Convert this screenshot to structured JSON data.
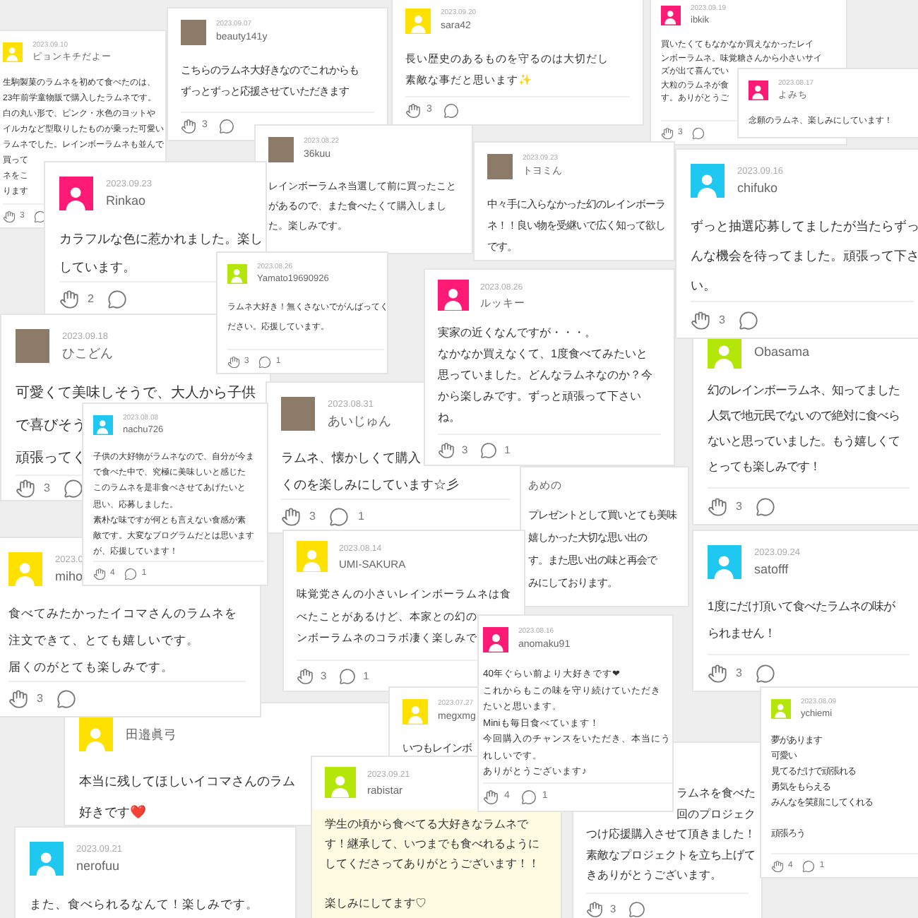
{
  "cards": [
    {
      "date": "2023.09.10",
      "name": "ピョンキチだよー",
      "avatar": {
        "kind": "icon",
        "color": "#ffe100"
      },
      "body": [
        [
          "生駒製菓のラムネを初めて食べたのは、",
          "23年前学童物販で購入したラムネです。",
          "白の丸い形で、ピンク・水色のヨットや",
          "イルカなど型取りしたものが乗った可愛い",
          "ラムネでした。レインボーラムネも並んで",
          "買って",
          "ネをこ",
          "ります"
        ]
      ],
      "footer": {
        "likes": "3"
      }
    },
    {
      "date": "2023.09.07",
      "name": "beauty141y",
      "avatar": {
        "kind": "photo"
      },
      "body": [
        [
          "こちらのラムネ大好きなのでこれからも",
          "ずっとずっと応援させていただきます"
        ]
      ],
      "footer": {
        "likes": "3"
      }
    },
    {
      "date": "2023.09.20",
      "name": "sara42",
      "avatar": {
        "kind": "icon",
        "color": "#ffe100"
      },
      "body": [
        [
          "長い歴史のあるものを守るのは大切だし",
          "素敵な事だと思います✨"
        ]
      ],
      "footer": {
        "likes": "3"
      }
    },
    {
      "date": "2023.09.19",
      "name": "ibkik",
      "avatar": {
        "kind": "icon",
        "color": "#ff1a75"
      },
      "body": [
        [
          "買いたくてもなかなか買えなかったレイ",
          "ンボーラムネ。味覚糖さんから小さいサイ",
          "ズが出て喜んでい",
          "大粒のラムネが食",
          "す。ありがとうご"
        ]
      ],
      "footer": {
        "likes": "3"
      }
    },
    {
      "date": "2023.08.17",
      "name": "よみち",
      "avatar": {
        "kind": "icon",
        "color": "#ff1a75"
      },
      "body": [
        [
          "念願のラムネ、楽しみにしています！"
        ]
      ]
    },
    {
      "date": "2023.08.22",
      "name": "36kuu",
      "avatar": {
        "kind": "photo"
      },
      "body": [
        [
          "レインボーラムネ当選して前に買ったこと",
          "があるので、また食べたくて購入しまし",
          "た。楽しみです。"
        ]
      ]
    },
    {
      "date": "2023.09.23",
      "name": "トヨミん",
      "avatar": {
        "kind": "photo"
      },
      "body": [
        [
          "中々手に入らなかった幻のレインボーラ",
          "ネ！！良い物を受継いで広く知って欲し",
          "です。"
        ]
      ]
    },
    {
      "date": "2023.09.23",
      "name": "Rinkao",
      "avatar": {
        "kind": "icon",
        "color": "#ff1a75"
      },
      "body": [
        [
          "カラフルな色に惹かれました。楽し",
          "しています。"
        ]
      ],
      "footer": {
        "likes": "2"
      }
    },
    {
      "date": "2023.09.16",
      "name": "chifuko",
      "avatar": {
        "kind": "icon",
        "color": "#1ec8f0"
      },
      "body": [
        [
          "ずっと抽選応募してましたが当たらずっ",
          "んな機会を待ってました。頑張って下さ",
          "い。"
        ]
      ],
      "footer": {
        "likes": "3"
      }
    },
    {
      "date": "2023.08.26",
      "name": "Yamato19690926",
      "avatar": {
        "kind": "icon",
        "color": "#b4e60a"
      },
      "body": [
        [
          "ラムネ大好き！無くさないでがんばってく",
          "ださい。応援しています。"
        ]
      ],
      "footer": {
        "likes": "3",
        "comments": "1"
      }
    },
    {
      "date": "2023.08.26",
      "name": "ルッキー",
      "avatar": {
        "kind": "icon",
        "color": "#ff1a75"
      },
      "body": [
        [
          "実家の近くなんですが・・・。",
          "なかなか買えなくて、1度食べてみたいと",
          "思っていました。どんなラムネなのか？今",
          "から楽しみです。ずっと頑張って下さい",
          "ね。"
        ]
      ],
      "footer": {
        "likes": "3",
        "comments": "1"
      }
    },
    {
      "date": "2023.09.18",
      "name": "ひこどん",
      "avatar": {
        "kind": "photo"
      },
      "body": [
        [
          "可愛くて美味しそうで、大人から子供",
          "で喜びそう",
          "頑張ってく"
        ]
      ],
      "footer": {
        "likes": "3"
      }
    },
    {
      "name": "Obasama",
      "avatar": {
        "kind": "icon",
        "color": "#b4e60a"
      },
      "body": [
        [
          "幻のレインボーラムネ、知ってました",
          "人気で地元民でないので絶対に食べら",
          "ないと思っていました。もう嬉しくて",
          "とっても楽しみです！"
        ]
      ],
      "footer": {
        "likes": "3"
      }
    },
    {
      "date": "2023.08.31",
      "name": "あいじゅん",
      "avatar": {
        "kind": "photo"
      },
      "body": [
        [
          "ラムネ、懐かしくて購入",
          "くのを楽しみにしています☆彡"
        ]
      ],
      "footer": {
        "likes": "3",
        "comments": "1"
      }
    },
    {
      "date": "2023.08.08",
      "name": "nachu726",
      "avatar": {
        "kind": "icon",
        "color": "#1ec8f0"
      },
      "body": [
        [
          "子供の大好物がラムネなので、自分が今ま",
          "で食べた中で、究極に美味しいと感じた",
          "このラムネを是非食べさせてあげたいと",
          "思い、応募しました。",
          "素朴な味ですが何とも言えない食感が素",
          "敵です。大変なプログラムだとは思います",
          "が、応援しています！"
        ]
      ],
      "footer": {
        "likes": "4",
        "comments": "1"
      }
    },
    {
      "name": "あめの",
      "body": [
        [
          "プレゼントとして買いとても美味",
          "嬉しかった大切な思い出の",
          "す。また思い出の味と再会で",
          "みにしております。"
        ]
      ]
    },
    {
      "date": "2023.0",
      "name": "miho",
      "avatar": {
        "kind": "icon",
        "color": "#ffe100"
      },
      "body": [
        [
          "食べてみたかったイコマさんのラムネを",
          "注文できて、とても嬉しいです。",
          "届くのがとても楽しみです。"
        ]
      ],
      "footer": {
        "likes": "3"
      }
    },
    {
      "date": "2023.08.14",
      "name": "UMI-SAKURA",
      "avatar": {
        "kind": "icon",
        "color": "#ffe100"
      },
      "body": [
        [
          "味覚党さんの小さいレインボーラムネは食",
          "べたことがあるけど、本家との幻の",
          "ンボーラムネのコラボ凄く楽しみで"
        ]
      ],
      "footer": {
        "likes": "3",
        "comments": "1"
      }
    },
    {
      "date": "2023.09.24",
      "name": "satofff",
      "avatar": {
        "kind": "icon",
        "color": "#1ec8f0"
      },
      "body": [
        [
          "1度にだけ頂いて食べたラムネの味が",
          "られません！"
        ]
      ],
      "footer": {
        "likes": "3"
      }
    },
    {
      "date": "2023.08.16",
      "name": "anomaku91",
      "avatar": {
        "kind": "icon",
        "color": "#ff1a75"
      },
      "body": [
        [
          "40年ぐらい前より大好きです❤",
          "これからもこの味を守り続けていただき",
          "たいと思います。",
          "Miniも毎日食べています！",
          "今回購入のチャンスをいただき、本当にう",
          "れしいです。",
          "ありがとうございます♪"
        ]
      ],
      "footer": {
        "likes": "4",
        "comments": "1"
      }
    },
    {
      "name": "田邉眞弓",
      "avatar": {
        "kind": "icon",
        "color": "#ffe100"
      },
      "body": [
        [
          "本当に残してほしいイコマさんのラム",
          "好きです❤️"
        ]
      ]
    },
    {
      "date": "2023.07.27",
      "name": "megxmg",
      "avatar": {
        "kind": "icon",
        "color": "#ffe100"
      },
      "body": [
        [
          "いつもレインボ"
        ]
      ]
    },
    {
      "date": "2023.09.21",
      "name": "rabistar",
      "avatar": {
        "kind": "icon",
        "color": "#b4e60a"
      },
      "highlighted": true,
      "body": [
        [
          "学生の頃から食べてる大好きなラムネで",
          "す！継承して、いつまでも食べれるように",
          "してくださってありがとうございます！！"
        ],
        [
          "楽しみにしてます♡"
        ]
      ]
    },
    {
      "body": [
        [
          "ラムネを食べた",
          "回のプロジェク",
          "つけ応援購入させて頂きました！",
          "素敵なプロジェクトを立ち上げて",
          "きありがとうございます。"
        ]
      ],
      "footer": {
        "likes": "3"
      }
    },
    {
      "date": "2023.08.09",
      "name": "ychiemi",
      "avatar": {
        "kind": "icon",
        "color": "#b4e60a"
      },
      "body": [
        [
          "夢があります",
          "可愛い",
          "見てるだけで頑張れる",
          "勇気をもらえる",
          "みんなを笑顔にしてくれる"
        ],
        [
          "頑張ろう"
        ]
      ],
      "footer": {
        "likes": "4",
        "comments": "1"
      }
    },
    {
      "date": "2023.09.21",
      "name": "nerofuu",
      "avatar": {
        "kind": "icon",
        "color": "#1ec8f0"
      },
      "body": [
        [
          "また、食べられるなんて！楽しみです。"
        ]
      ]
    }
  ]
}
